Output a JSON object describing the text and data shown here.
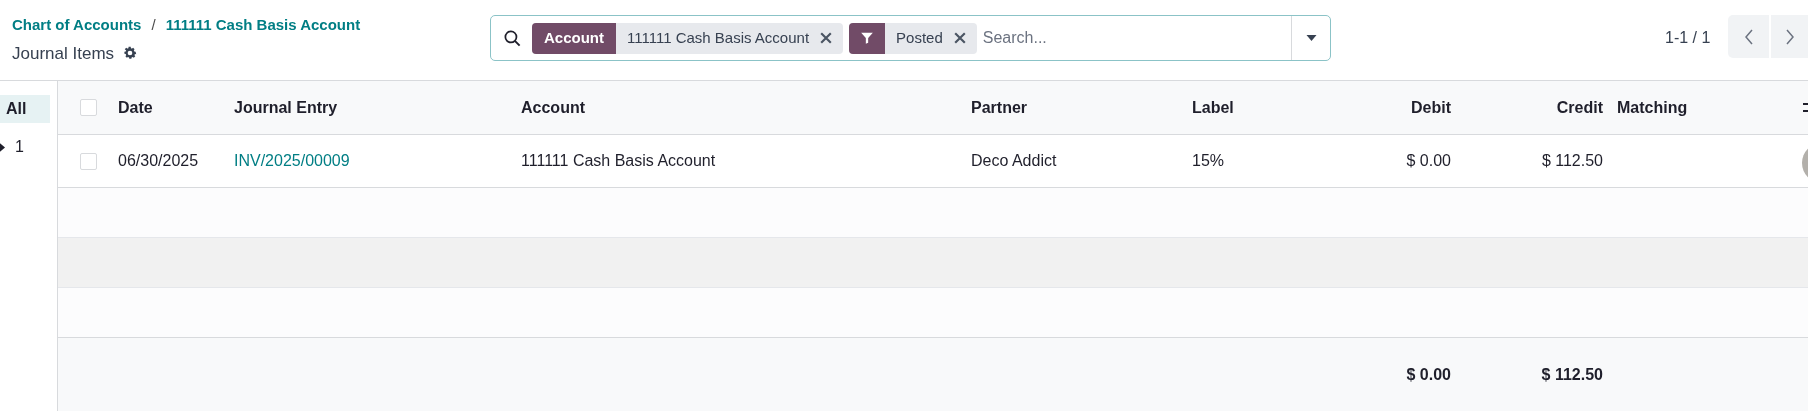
{
  "breadcrumbs": [
    {
      "label": "Chart of Accounts"
    },
    {
      "label": "111111 Cash Basis Account"
    }
  ],
  "breadcrumb_separator": "/",
  "title": "Journal Items",
  "search": {
    "placeholder": "Search...",
    "facets": [
      {
        "kind": "field",
        "label": "Account",
        "value": "111111 Cash Basis Account"
      },
      {
        "kind": "filter",
        "value": "Posted"
      }
    ]
  },
  "pager": "1-1 / 1",
  "sidebar": {
    "items": [
      {
        "label": "All",
        "selected": true
      },
      {
        "label": "1",
        "selected": false,
        "expanded": false
      }
    ]
  },
  "table": {
    "select_all": false,
    "columns": [
      {
        "label": "Date",
        "kind": "text"
      },
      {
        "label": "Journal Entry",
        "kind": "link"
      },
      {
        "label": "Account",
        "kind": "text"
      },
      {
        "label": "Partner",
        "kind": "text"
      },
      {
        "label": "Label",
        "kind": "text"
      },
      {
        "label": "Debit",
        "kind": "money",
        "total": "$ 0.00"
      },
      {
        "label": "Credit",
        "kind": "money",
        "total": "$ 112.50"
      },
      {
        "label": "Matching",
        "kind": "text"
      }
    ],
    "rows": [
      {
        "checked": false,
        "cells": [
          "06/30/2025",
          "INV/2025/00009",
          "111111 Cash Basis Account",
          "Deco Addict",
          "15%",
          "$ 0.00",
          "$ 112.50"
        ]
      }
    ]
  }
}
